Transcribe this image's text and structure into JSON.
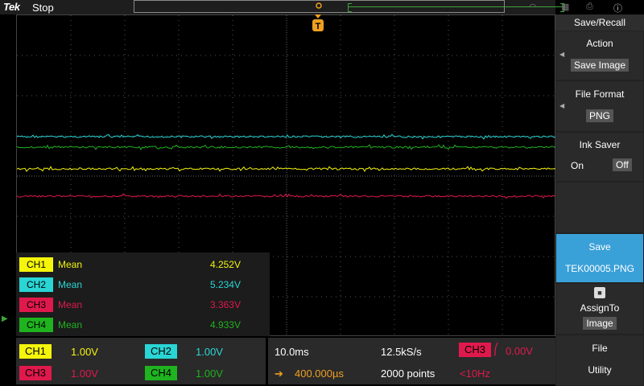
{
  "topbar": {
    "logo": "Tek",
    "status": "Stop"
  },
  "trigger": {
    "label": "T"
  },
  "measurements": [
    {
      "channel": "CH1",
      "name": "Mean",
      "value": "4.252V",
      "color": "#f5f50a"
    },
    {
      "channel": "CH2",
      "name": "Mean",
      "value": "5.234V",
      "color": "#2ad5d5"
    },
    {
      "channel": "CH3",
      "name": "Mean",
      "value": "3.363V",
      "color": "#e0194d"
    },
    {
      "channel": "CH4",
      "name": "Mean",
      "value": "4.933V",
      "color": "#1fb31f"
    }
  ],
  "vertical": {
    "ch1": {
      "label": "CH1",
      "scale": "1.00V",
      "color": "#f5f50a"
    },
    "ch2": {
      "label": "CH2",
      "scale": "1.00V",
      "color": "#2ad5d5"
    },
    "ch3": {
      "label": "CH3",
      "scale": "1.00V",
      "color": "#e0194d"
    },
    "ch4": {
      "label": "CH4",
      "scale": "1.00V",
      "color": "#1fb31f"
    }
  },
  "horizontal": {
    "timebase": "10.0ms",
    "sample_rate": "12.5kS/s",
    "delay": "400.000µs",
    "record_length": "2000 points",
    "trigger_source": "CH3",
    "trigger_level": "0.00V",
    "trigger_freq": "<10Hz"
  },
  "menu": {
    "title": "Save/Recall",
    "action_label": "Action",
    "action_value": "Save Image",
    "format_label": "File Format",
    "format_value": "PNG",
    "ink_label": "Ink Saver",
    "ink_on": "On",
    "ink_off": "Off",
    "save_label": "Save",
    "save_file": "TEK00005.PNG",
    "assign_label": "AssignTo",
    "assign_value": "Image",
    "file_label": "File",
    "utility_label": "Utility"
  },
  "colors": {
    "ch1": "#f5f50a",
    "ch2": "#2ad5d5",
    "ch3": "#e0194d",
    "ch4": "#1fb31f",
    "accent": "#3aa0d8",
    "trigger": "#f0a020"
  }
}
